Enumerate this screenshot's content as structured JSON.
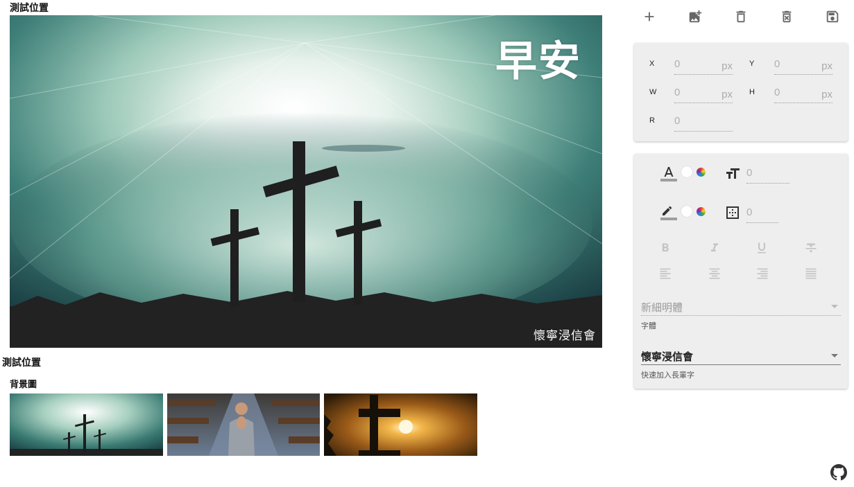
{
  "labels": {
    "preview_title": "測試位置",
    "section_title": "測試位置",
    "backgrounds_title": "背景圖"
  },
  "canvas": {
    "title_text": "早安",
    "footer_text": "懷寧浸信會"
  },
  "thumbnails": [
    {
      "name": "three-crosses"
    },
    {
      "name": "praying-man"
    },
    {
      "name": "cross-sunset"
    }
  ],
  "toolbar": [
    {
      "icon": "plus-icon"
    },
    {
      "icon": "add-image-icon"
    },
    {
      "icon": "delete-icon"
    },
    {
      "icon": "delete-forever-icon"
    },
    {
      "icon": "save-icon"
    }
  ],
  "position_panel": {
    "x_label": "X",
    "y_label": "Y",
    "w_label": "W",
    "h_label": "H",
    "r_label": "R",
    "x_placeholder": "0",
    "y_placeholder": "0",
    "w_placeholder": "0",
    "h_placeholder": "0",
    "r_placeholder": "0",
    "unit": "px"
  },
  "style_panel": {
    "font_size_placeholder": "0",
    "stroke_width_placeholder": "0",
    "font_family_value": "新細明體",
    "font_family_helper": "字體",
    "quick_text_value": "懷寧浸信會",
    "quick_text_helper": "快速加入長輩字"
  },
  "colors": {
    "panel_bg": "#eeeeee",
    "text_color_swatch": "#ffffff",
    "stroke_color_swatch": "#ffffff"
  }
}
